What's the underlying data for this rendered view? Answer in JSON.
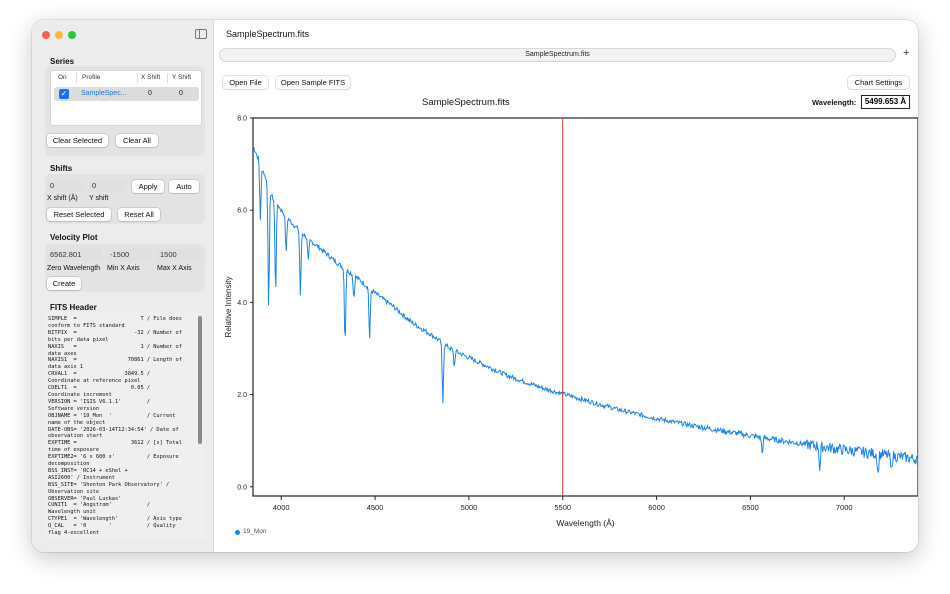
{
  "window": {
    "title": "SampleSpectrum.fits",
    "tab_label": "SampleSpectrum.fits"
  },
  "sidebar": {
    "series": {
      "title": "Series",
      "columns": [
        "On",
        "Profile",
        "X Shift",
        "Y Shift"
      ],
      "rows": [
        {
          "on": true,
          "profile": "SampleSpec...",
          "x_shift": "0",
          "y_shift": "0"
        }
      ],
      "clear_selected_label": "Clear Selected",
      "clear_all_label": "Clear All"
    },
    "shifts": {
      "title": "Shifts",
      "x_value": "0",
      "y_value": "0",
      "apply_label": "Apply",
      "auto_label": "Auto",
      "x_label": "X shift (Å)",
      "y_label": "Y shift",
      "reset_selected_label": "Reset Selected",
      "reset_all_label": "Reset All"
    },
    "velocity": {
      "title": "Velocity Plot",
      "zero_value": "6562.801",
      "min_value": "-1500",
      "max_value": "1500",
      "zero_label": "Zero Wavelength",
      "min_label": "Min X Axis",
      "max_label": "Max X Axis",
      "create_label": "Create"
    },
    "fits": {
      "title": "FITS Header",
      "text": "SIMPLE  =                    T / File does\nconform to FITS standard\nBITPIX  =                  -32 / Number of\nbits per data pixel\nNAXIS   =                    1 / Number of\ndata axes\nNAXIS1  =                70861 / Length of\ndata axis 1\nCRVAL1  =               3849.5 /\nCoordinate at reference pixel\nCDELT1  =                 0.05 /\nCoordinate increment\nVERSION = 'ISIS V6.1.1'        /\nSoftware version\nOBJNAME = '19_Mon  '           / Current\nname of the object\nDATE-OBS= '2026-03-14T12:34:54' / Date of\nobservation start\nEXPTIME =                 3612 / [s] Total\ntime of exposure\nEXPTIME2= '6 x 600 s'          / Exposure\ndecomposition\nBSS_INST= 'RC14 + eShel +\nASI2600' / Instrument\nBSS_SITE= 'Shenton Park Observatory' /\nObservation site\nOBSERVER= 'Paul Luckas'\nCUNIT1  = 'Angstrom'           /\nWavelength unit\nCTYPE1  = 'Wavelength'         / Axis type\nQ_CAL   = '0       '           / Quality\nflag 4-excellent"
    }
  },
  "toolbar": {
    "open_file_label": "Open File",
    "open_sample_label": "Open Sample FITS",
    "chart_settings_label": "Chart Settings",
    "wavelength_label": "Wavelength:",
    "wavelength_value": "5499.653 Å"
  },
  "colors": {
    "series": "#1a84e6",
    "cursor": "#d93a2b",
    "checkbox": "#1a73e8"
  },
  "chart_data": {
    "type": "line",
    "title": "SampleSpectrum.fits",
    "xlabel": "Wavelength (Å)",
    "ylabel": "Relative Intensity",
    "xlim": [
      3849.5,
      7393
    ],
    "ylim": [
      -0.2,
      8.0
    ],
    "xticks": [
      4000,
      4500,
      5000,
      5500,
      6000,
      6500,
      7000
    ],
    "yticks": [
      0.0,
      2.0,
      4.0,
      6.0,
      8.0
    ],
    "cursor_x": 5499.653,
    "series": [
      {
        "name": "19_Mon",
        "x": [
          3850,
          3900,
          3950,
          4000,
          4050,
          4100,
          4150,
          4200,
          4300,
          4400,
          4500,
          4600,
          4700,
          4800,
          4900,
          5000,
          5200,
          5400,
          5600,
          5800,
          6000,
          6200,
          6400,
          6600,
          6800,
          7000,
          7200,
          7393
        ],
        "y": [
          7.4,
          6.9,
          6.3,
          6.0,
          5.75,
          5.55,
          5.35,
          5.2,
          4.85,
          4.55,
          4.2,
          3.9,
          3.55,
          3.3,
          3.0,
          2.8,
          2.42,
          2.13,
          1.9,
          1.67,
          1.48,
          1.32,
          1.18,
          1.04,
          0.92,
          0.8,
          0.7,
          0.6
        ]
      }
    ],
    "absorption_lines": [
      {
        "x": 3889,
        "depth": 1.2
      },
      {
        "x": 3933,
        "depth": 2.6
      },
      {
        "x": 3970,
        "depth": 2.0
      },
      {
        "x": 4026,
        "depth": 0.8
      },
      {
        "x": 4102,
        "depth": 1.4
      },
      {
        "x": 4144,
        "depth": 0.5
      },
      {
        "x": 4340,
        "depth": 1.6
      },
      {
        "x": 4387,
        "depth": 0.5
      },
      {
        "x": 4471,
        "depth": 1.1
      },
      {
        "x": 4861,
        "depth": 1.3
      },
      {
        "x": 4922,
        "depth": 0.35
      },
      {
        "x": 6563,
        "depth": 0.35
      },
      {
        "x": 6870,
        "depth": 0.5
      },
      {
        "x": 7180,
        "depth": 0.45
      },
      {
        "x": 7250,
        "depth": 0.35
      }
    ]
  }
}
